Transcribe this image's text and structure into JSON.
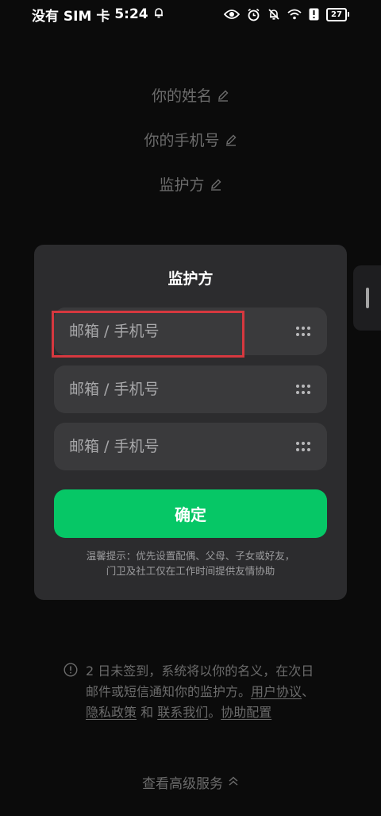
{
  "status_bar": {
    "carrier": "没有 SIM 卡",
    "time": "5:24",
    "battery": "27"
  },
  "profile": {
    "name_label": "你的姓名",
    "phone_label": "你的手机号",
    "guardian_label": "监护方"
  },
  "modal": {
    "title": "监护方",
    "inputs": [
      {
        "placeholder": "邮箱 / 手机号",
        "value": ""
      },
      {
        "placeholder": "邮箱 / 手机号",
        "value": ""
      },
      {
        "placeholder": "邮箱 / 手机号",
        "value": ""
      }
    ],
    "confirm_label": "确定",
    "tip_line1": "温馨提示：优先设置配偶、父母、子女或好友，",
    "tip_line2": "门卫及社工仅在工作时间提供友情协助",
    "highlight_color": "#d6383f",
    "confirm_color": "#06c766"
  },
  "notice": {
    "text_part1": "2 日未签到，系统将以你的名义，在次日邮件或短信通知你的监护方。",
    "link_user_agreement": "用户协议",
    "sep1": "、",
    "link_privacy": "隐私政策",
    "sep2": " 和 ",
    "link_contact": "联系我们",
    "sep3": "。",
    "link_help": "协助配置"
  },
  "advanced": {
    "label": "查看高级服务"
  }
}
